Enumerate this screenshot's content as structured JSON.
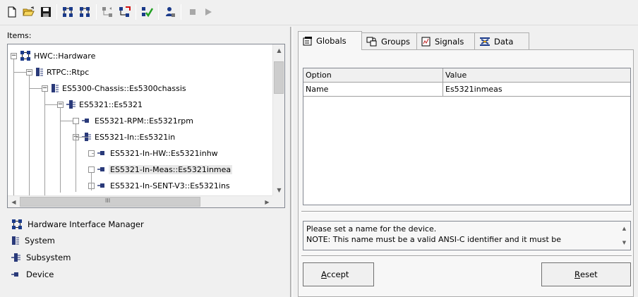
{
  "toolbar": {
    "buttons": [
      {
        "name": "new-file-button",
        "icon": "new-document-icon"
      },
      {
        "name": "open-file-button",
        "icon": "folder-open-icon"
      },
      {
        "name": "save-button",
        "icon": "floppy-disk-icon"
      },
      {
        "name": "add-system-button",
        "icon": "tree-add-icon"
      },
      {
        "name": "add-subsystem-button",
        "icon": "tree-add-alt-icon"
      },
      {
        "name": "move-up-button",
        "icon": "tree-move-icon"
      },
      {
        "name": "move-down-button",
        "icon": "tree-move-red-icon"
      },
      {
        "name": "check-button",
        "icon": "check-icon"
      },
      {
        "name": "connect-button",
        "icon": "user-connect-icon"
      },
      {
        "name": "stop-button",
        "icon": "stop-icon"
      },
      {
        "name": "play-button",
        "icon": "play-icon"
      }
    ]
  },
  "left": {
    "items_label": "Items:",
    "tree": [
      {
        "label": "HWC::Hardware",
        "level": 0,
        "type": "hwm",
        "expander": "minus"
      },
      {
        "label": "RTPC::Rtpc",
        "level": 1,
        "type": "system",
        "expander": "minus"
      },
      {
        "label": "ES5300-Chassis::Es5300chassis",
        "level": 2,
        "type": "system",
        "expander": "minus"
      },
      {
        "label": "ES5321::Es5321",
        "level": 3,
        "type": "subsystem",
        "expander": "minus"
      },
      {
        "label": "ES5321-RPM::Es5321rpm",
        "level": 4,
        "type": "device",
        "expander": "leaf"
      },
      {
        "label": "ES5321-In::Es5321in",
        "level": 4,
        "type": "subsystem",
        "expander": "minus"
      },
      {
        "label": "ES5321-In-HW::Es5321inhw",
        "level": 5,
        "type": "device",
        "expander": "leaf"
      },
      {
        "label": "ES5321-In-Meas::Es5321inmea",
        "level": 5,
        "type": "device",
        "expander": "leaf",
        "selected": true
      },
      {
        "label": "ES5321-In-SENT-V3::Es5321ins",
        "level": 5,
        "type": "device",
        "expander": "leaf"
      }
    ],
    "hscroll_glyph": "III",
    "legend": [
      {
        "label": "Hardware Interface Manager",
        "icon": "hardware-interface-manager-icon"
      },
      {
        "label": "System",
        "icon": "system-icon"
      },
      {
        "label": "Subsystem",
        "icon": "subsystem-icon"
      },
      {
        "label": "Device",
        "icon": "device-icon"
      }
    ]
  },
  "right": {
    "tabs": [
      {
        "label": "Globals",
        "icon": "globals-icon",
        "active": true
      },
      {
        "label": "Groups",
        "icon": "groups-icon",
        "active": false
      },
      {
        "label": "Signals",
        "icon": "signals-icon",
        "active": false
      },
      {
        "label": "Data",
        "icon": "data-icon",
        "active": false
      }
    ],
    "grid": {
      "headers": [
        "Option",
        "Value"
      ],
      "rows": [
        [
          "Name",
          "Es5321inmeas"
        ]
      ]
    },
    "message": [
      "Please set a name for the device.",
      "NOTE: This name must be a valid ANSI-C identifier and it must be"
    ],
    "accept": {
      "prefix": "",
      "accel": "A",
      "rest": "ccept"
    },
    "reset": {
      "prefix": "",
      "accel": "R",
      "rest": "eset"
    }
  }
}
